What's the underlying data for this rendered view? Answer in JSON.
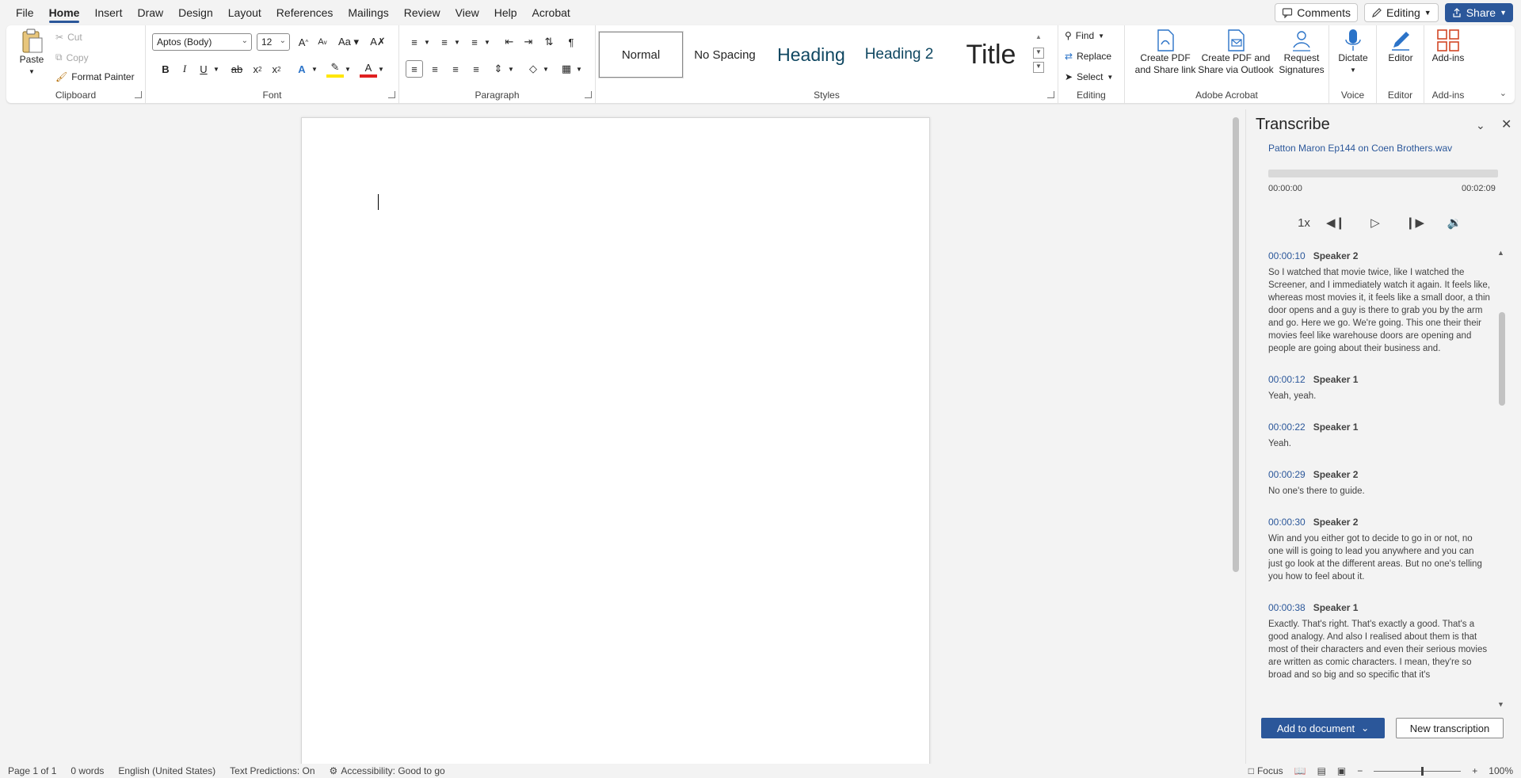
{
  "menu": {
    "tabs": [
      "File",
      "Home",
      "Insert",
      "Draw",
      "Design",
      "Layout",
      "References",
      "Mailings",
      "Review",
      "View",
      "Help",
      "Acrobat"
    ],
    "active_tab": "Home",
    "comments_label": "Comments",
    "editing_label": "Editing",
    "share_label": "Share"
  },
  "ribbon": {
    "clipboard": {
      "label": "Clipboard",
      "paste": "Paste",
      "cut": "Cut",
      "copy": "Copy",
      "format_painter": "Format Painter"
    },
    "font": {
      "label": "Font",
      "font_name": "Aptos (Body)",
      "font_size": "12"
    },
    "paragraph": {
      "label": "Paragraph"
    },
    "styles": {
      "label": "Styles",
      "items": [
        "Normal",
        "No Spacing",
        "Heading",
        "Heading 2",
        "Title"
      ]
    },
    "editing": {
      "label": "Editing",
      "find": "Find",
      "replace": "Replace",
      "select": "Select"
    },
    "acrobat": {
      "label": "Adobe Acrobat",
      "create_share": [
        "Create PDF",
        "and Share link"
      ],
      "create_outlook": [
        "Create PDF and",
        "Share via Outlook"
      ],
      "request": [
        "Request",
        "Signatures"
      ]
    },
    "voice": {
      "label": "Voice",
      "dictate": "Dictate"
    },
    "editor": {
      "label": "Editor",
      "editor": "Editor"
    },
    "addins": {
      "label": "Add-ins",
      "addins": "Add-ins"
    }
  },
  "pane": {
    "title": "Transcribe",
    "file": "Patton Maron Ep144 on Coen Brothers.wav",
    "time_start": "00:00:00",
    "time_end": "00:02:09",
    "speed": "1x",
    "entries": [
      {
        "time": "00:00:10",
        "speaker": "Speaker 2",
        "text": "So I watched that movie twice, like I watched the Screener, and I immediately watch it again. It feels like, whereas most movies it, it feels like a small door, a thin door opens and a guy is there to grab you by the arm and go. Here we go. We're going. This one their their movies feel like warehouse doors are opening and people are going about their business and."
      },
      {
        "time": "00:00:12",
        "speaker": "Speaker 1",
        "text": "Yeah, yeah."
      },
      {
        "time": "00:00:22",
        "speaker": "Speaker 1",
        "text": "Yeah."
      },
      {
        "time": "00:00:29",
        "speaker": "Speaker 2",
        "text": "No one's there to guide."
      },
      {
        "time": "00:00:30",
        "speaker": "Speaker 2",
        "text": "Win and you either got to decide to go in or not, no one will is going to lead you anywhere and you can just go look at the different areas. But no one's telling you how to feel about it."
      },
      {
        "time": "00:00:38",
        "speaker": "Speaker 1",
        "text": "Exactly. That's right. That's exactly a good. That's a good analogy. And also I realised about them is that most of their characters and even their serious movies are written as comic characters. I mean, they're so broad and so big and so specific that it's"
      }
    ],
    "add_button": "Add to document",
    "new_button": "New transcription"
  },
  "status": {
    "page": "Page 1 of 1",
    "words": "0 words",
    "language": "English (United States)",
    "predictions": "Text Predictions: On",
    "accessibility": "Accessibility: Good to go",
    "focus": "Focus",
    "zoom": "100%"
  },
  "colors": {
    "accent": "#2b579a",
    "background": "#f3f3f3"
  }
}
